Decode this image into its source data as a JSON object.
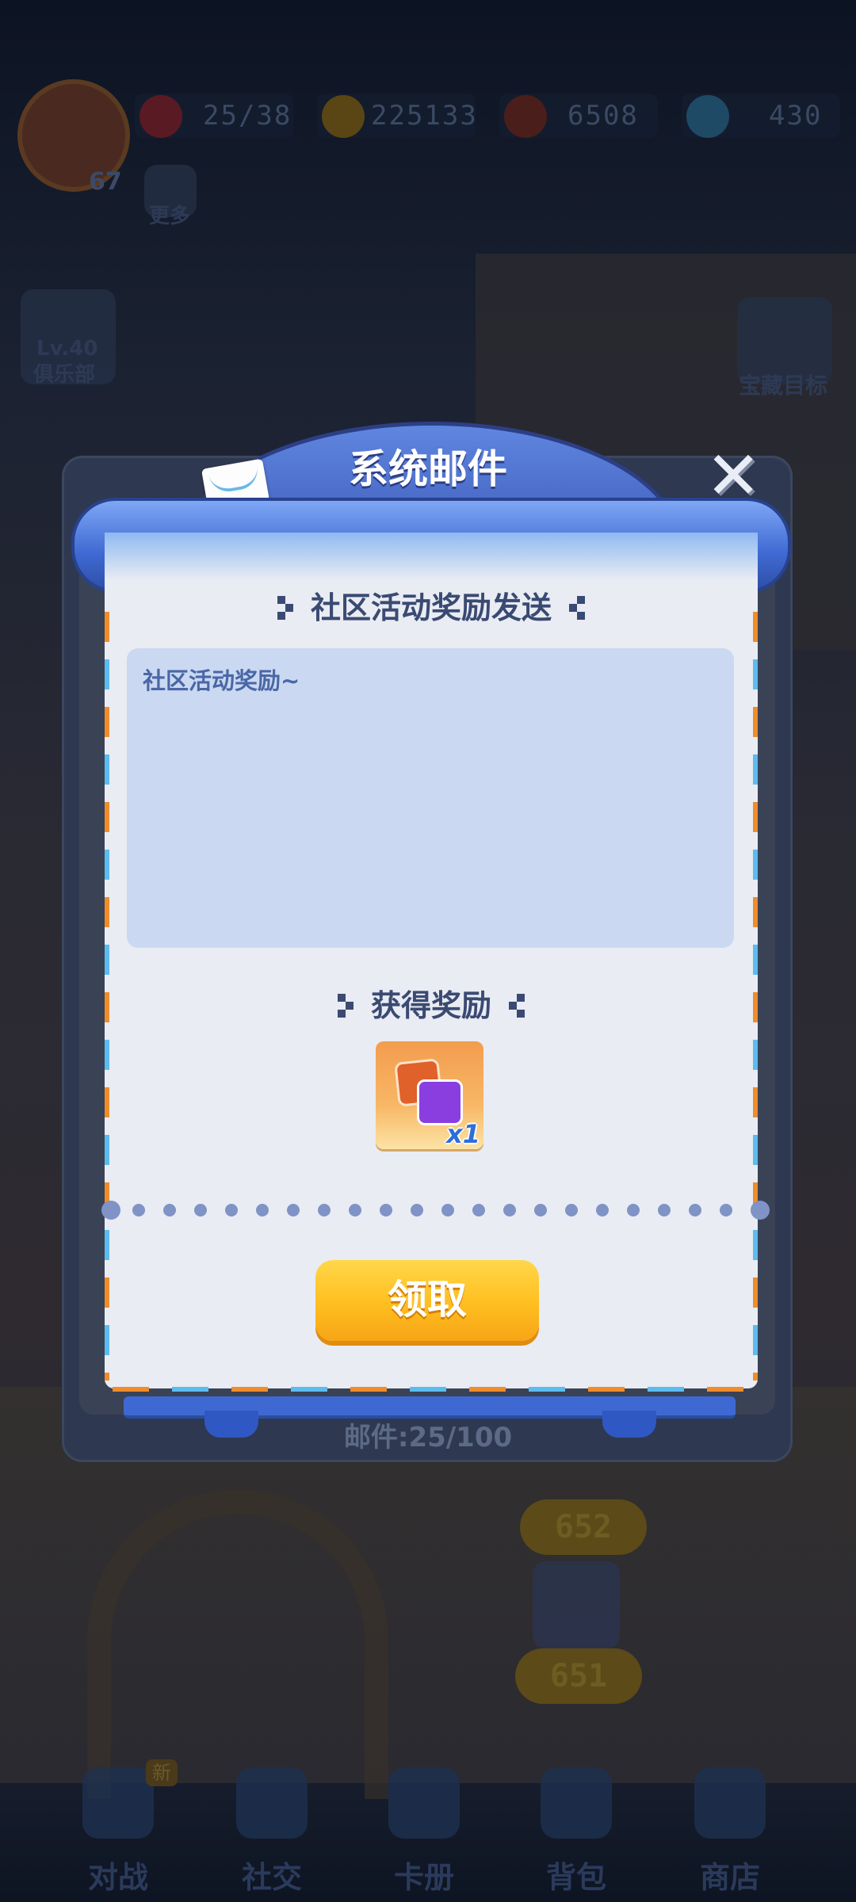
{
  "hud": {
    "level": "67",
    "hearts": "25/38",
    "coins": "225133",
    "stamina": "6508",
    "diamonds": "430"
  },
  "side_labels": {
    "more": "更多",
    "club_level": "Lv.40",
    "club": "俱乐部",
    "treasure": "宝藏目标"
  },
  "scores": [
    "652",
    "651"
  ],
  "bottom_nav": {
    "items": [
      {
        "label": "对战",
        "badge": "新"
      },
      {
        "label": "社交"
      },
      {
        "label": "卡册"
      },
      {
        "label": "背包"
      },
      {
        "label": "商店"
      }
    ]
  },
  "dialog": {
    "title": "系统邮件",
    "close_icon": "close-x",
    "mail_subject": "社区活动奖励发送",
    "mail_body": "社区活动奖励~",
    "rewards_title": "获得奖励",
    "reward": {
      "icon": "card-pack",
      "quantity": "x1"
    },
    "claim_label": "领取",
    "mail_count": "邮件:25/100"
  },
  "colors": {
    "dialog_blue": "#3f69d2",
    "paper": "#e9ecf3",
    "message_box": "#cad9f1",
    "claim_button": "#ffbe1f"
  }
}
